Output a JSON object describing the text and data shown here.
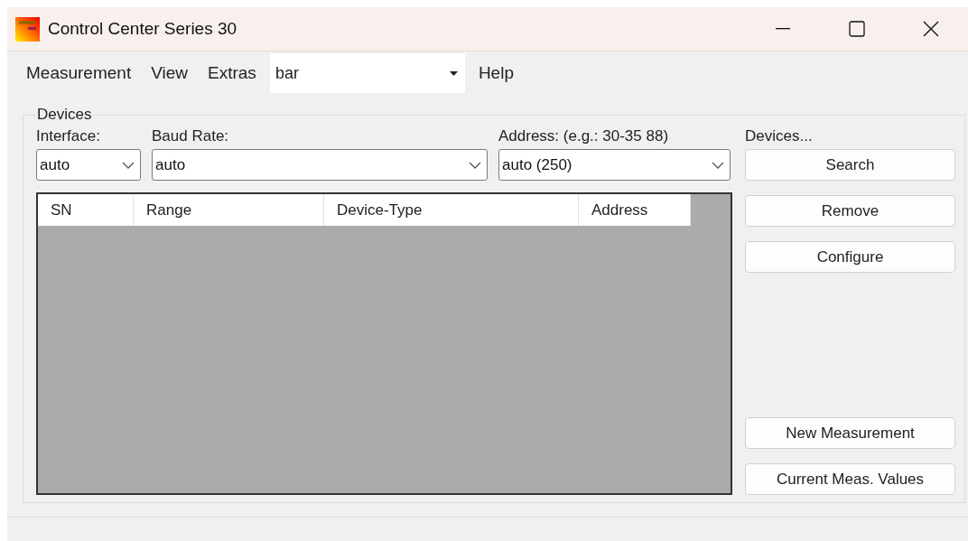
{
  "window": {
    "title": "Control Center Series 30"
  },
  "menu": [
    {
      "kind": "menu",
      "label": "Measurement"
    },
    {
      "kind": "menu",
      "label": "View"
    },
    {
      "kind": "menu",
      "label": "Extras"
    },
    {
      "kind": "combo",
      "value": "bar"
    },
    {
      "kind": "menu",
      "label": "Help"
    }
  ],
  "group": {
    "title": "Devices",
    "fields": [
      {
        "label": "Interface:",
        "value": "auto"
      },
      {
        "label": "Baud Rate:",
        "value": "auto"
      },
      {
        "label": "Address: (e.g.: 30-35 88)",
        "value": "auto (250)"
      }
    ],
    "table": {
      "columns": [
        "SN",
        "Range",
        "Device-Type",
        "Address"
      ]
    },
    "buttons_label": "Devices...",
    "top_buttons": [
      "Search",
      "Remove",
      "Configure"
    ],
    "bottom_buttons": [
      "New Measurement",
      "Current Meas. Values"
    ]
  }
}
